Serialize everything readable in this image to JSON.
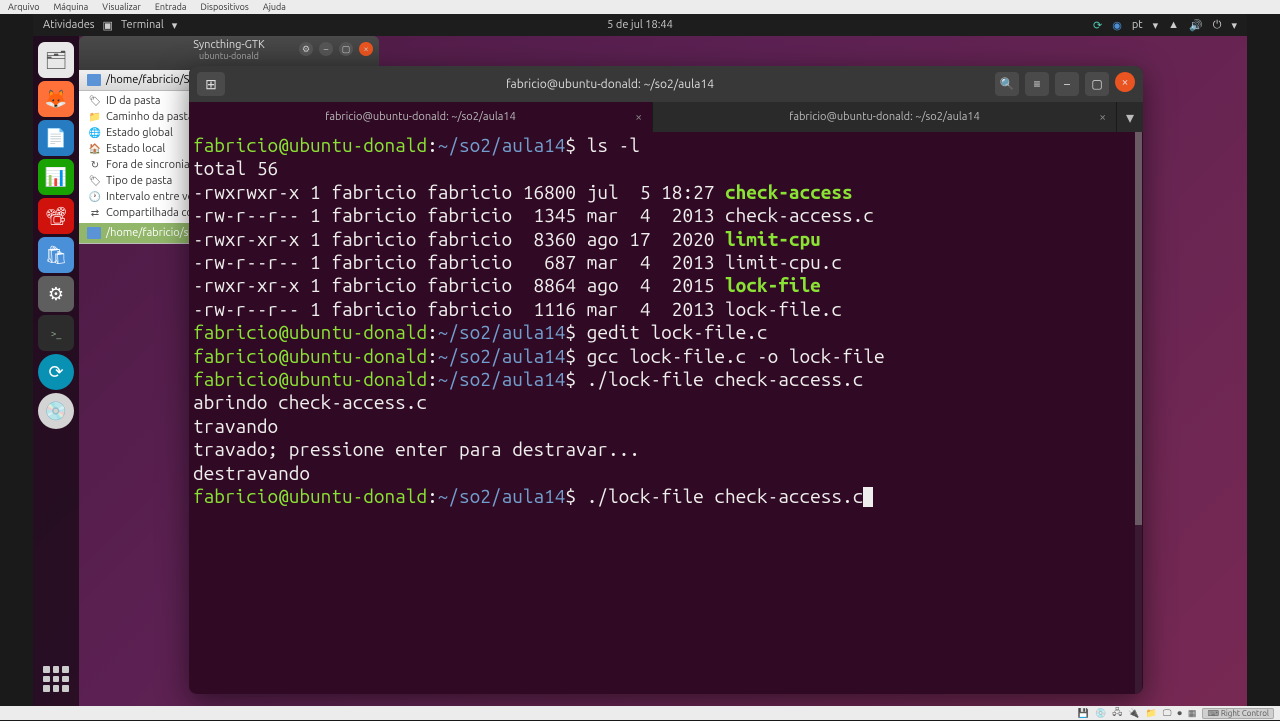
{
  "vm_menu": [
    "Arquivo",
    "Máquina",
    "Visualizar",
    "Entrada",
    "Dispositivos",
    "Ajuda"
  ],
  "topbar": {
    "activities": "Atividades",
    "app": "Terminal",
    "datetime": "5 de jul  18:44",
    "lang": "pt"
  },
  "syncthing": {
    "title": "Syncthing-GTK",
    "subtitle": "ubuntu-donald",
    "folder_path": "/home/fabricio/S",
    "items": [
      {
        "icon": "tag",
        "label": "ID da pasta"
      },
      {
        "icon": "folder",
        "label": "Caminho da pasta"
      },
      {
        "icon": "globe",
        "label": "Estado global"
      },
      {
        "icon": "home",
        "label": "Estado local"
      },
      {
        "icon": "refresh",
        "label": "Fora de sincronia"
      },
      {
        "icon": "tag",
        "label": "Tipo de pasta"
      },
      {
        "icon": "clock",
        "label": "Intervalo entre verifica"
      },
      {
        "icon": "share",
        "label": "Compartilhada com"
      }
    ],
    "selected_folder": "/home/fabricio/so"
  },
  "terminal": {
    "window_title": "fabricio@ubuntu-donald: ~/so2/aula14",
    "tabs": [
      {
        "label": "fabricio@ubuntu-donald: ~/so2/aula14",
        "active": true
      },
      {
        "label": "fabricio@ubuntu-donald: ~/so2/aula14",
        "active": false
      }
    ],
    "prompt_user": "fabricio@ubuntu-donald",
    "prompt_path": "~/so2/aula14",
    "lines": {
      "cmd1": "ls -l",
      "total": "total 56",
      "l1_perm": "-rwxrwxr-x 1 fabricio fabricio 16800 jul  5 18:27 ",
      "l1_name": "check-access",
      "l2": "-rw-r--r-- 1 fabricio fabricio  1345 mar  4  2013 check-access.c",
      "l3_perm": "-rwxr-xr-x 1 fabricio fabricio  8360 ago 17  2020 ",
      "l3_name": "limit-cpu",
      "l4": "-rw-r--r-- 1 fabricio fabricio   687 mar  4  2013 limit-cpu.c",
      "l5_perm": "-rwxr-xr-x 1 fabricio fabricio  8864 ago  4  2015 ",
      "l5_name": "lock-file",
      "l6": "-rw-r--r-- 1 fabricio fabricio  1116 mar  4  2013 lock-file.c",
      "cmd2": "gedit lock-file.c",
      "cmd3": "gcc lock-file.c -o lock-file",
      "cmd4": "./lock-file check-access.c",
      "out1": "abrindo check-access.c",
      "out2": "travando",
      "out3": "travado; pressione enter para destravar...",
      "out4": "destravando",
      "cmd5": "./lock-file check-access.c"
    }
  },
  "vm_status": {
    "right_ctrl": "Right Control"
  }
}
